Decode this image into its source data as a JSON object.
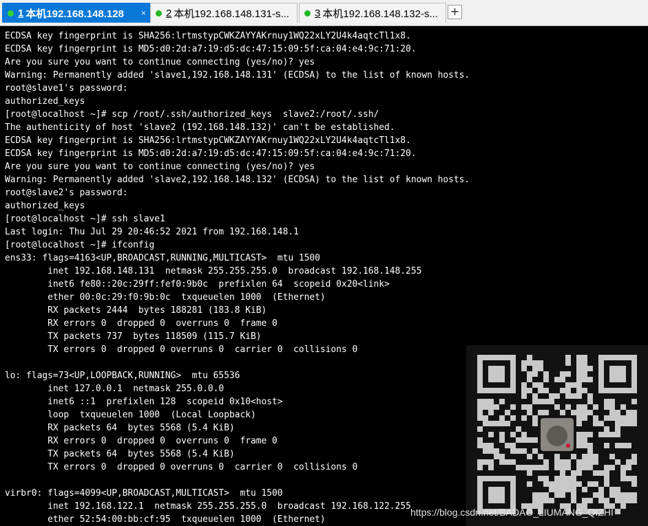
{
  "tabs": [
    {
      "number": "1",
      "title": "本机192.168.148.128",
      "active": true
    },
    {
      "number": "2",
      "title": "本机192.168.148.131-s...",
      "active": false
    },
    {
      "number": "3",
      "title": "本机192.168.148.132-s...",
      "active": false
    }
  ],
  "tab_close_icon": "×",
  "new_tab_icon": "+",
  "terminal_lines": [
    "ECDSA key fingerprint is SHA256:lrtmstypCWKZAYYAKrnuy1WQ22xLY2U4k4aqtcTl1x8.",
    "ECDSA key fingerprint is MD5:d0:2d:a7:19:d5:dc:47:15:09:5f:ca:04:e4:9c:71:20.",
    "Are you sure you want to continue connecting (yes/no)? yes",
    "Warning: Permanently added 'slave1,192.168.148.131' (ECDSA) to the list of known hosts.",
    "root@slave1's password:",
    "authorized_keys",
    "[root@localhost ~]# scp /root/.ssh/authorized_keys  slave2:/root/.ssh/",
    "The authenticity of host 'slave2 (192.168.148.132)' can't be established.",
    "ECDSA key fingerprint is SHA256:lrtmstypCWKZAYYAKrnuy1WQ22xLY2U4k4aqtcTl1x8.",
    "ECDSA key fingerprint is MD5:d0:2d:a7:19:d5:dc:47:15:09:5f:ca:04:e4:9c:71:20.",
    "Are you sure you want to continue connecting (yes/no)? yes",
    "Warning: Permanently added 'slave2,192.168.148.132' (ECDSA) to the list of known hosts.",
    "root@slave2's password:",
    "authorized_keys",
    "[root@localhost ~]# ssh slave1",
    "Last login: Thu Jul 29 20:46:52 2021 from 192.168.148.1",
    "[root@localhost ~]# ifconfig",
    "ens33: flags=4163<UP,BROADCAST,RUNNING,MULTICAST>  mtu 1500",
    "        inet 192.168.148.131  netmask 255.255.255.0  broadcast 192.168.148.255",
    "        inet6 fe80::20c:29ff:fef0:9b0c  prefixlen 64  scopeid 0x20<link>",
    "        ether 00:0c:29:f0:9b:0c  txqueuelen 1000  (Ethernet)",
    "        RX packets 2444  bytes 188281 (183.8 KiB)",
    "        RX errors 0  dropped 0  overruns 0  frame 0",
    "        TX packets 737  bytes 118509 (115.7 KiB)",
    "        TX errors 0  dropped 0 overruns 0  carrier 0  collisions 0",
    "",
    "lo: flags=73<UP,LOOPBACK,RUNNING>  mtu 65536",
    "        inet 127.0.0.1  netmask 255.0.0.0",
    "        inet6 ::1  prefixlen 128  scopeid 0x10<host>",
    "        loop  txqueuelen 1000  (Local Loopback)",
    "        RX packets 64  bytes 5568 (5.4 KiB)",
    "        RX errors 0  dropped 0  overruns 0  frame 0",
    "        TX packets 64  bytes 5568 (5.4 KiB)",
    "        TX errors 0  dropped 0 overruns 0  carrier 0  collisions 0",
    "",
    "virbr0: flags=4099<UP,BROADCAST,MULTICAST>  mtu 1500",
    "        inet 192.168.122.1  netmask 255.255.255.0  broadcast 192.168.122.255",
    "        ether 52:54:00:bb:cf:95  txqueuelen 1000  (Ethernet)"
  ],
  "watermark": "https://blog.csdn.net/BADAO_LIUMANG_QIZHI",
  "colors": {
    "terminal_background": "#000000",
    "terminal_text": "#ffffff",
    "active_tab": "#0a78d7",
    "connected_dot": "#25b625"
  }
}
